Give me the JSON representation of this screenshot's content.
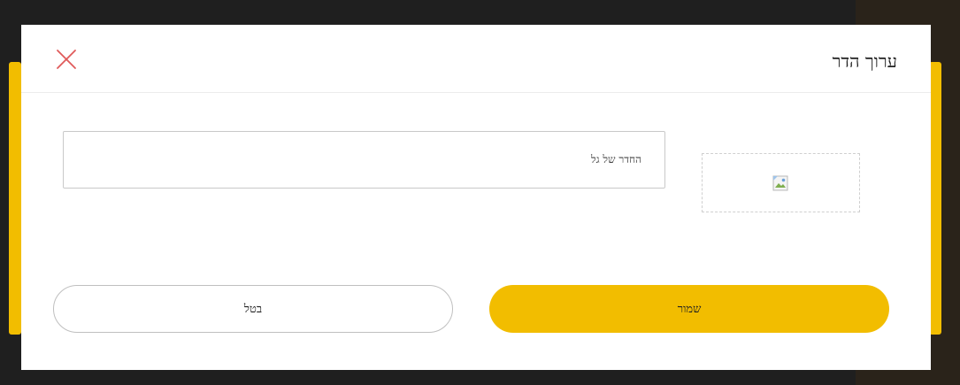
{
  "modal": {
    "title": "ערוך הדר",
    "close_icon": "close-icon",
    "accent_color": "#f2bd00",
    "close_color": "#e05a5a"
  },
  "form": {
    "image_icon": "broken-image-icon",
    "room_name_value": "החדר של גל"
  },
  "actions": {
    "save_label": "שמור",
    "cancel_label": "בטל"
  }
}
